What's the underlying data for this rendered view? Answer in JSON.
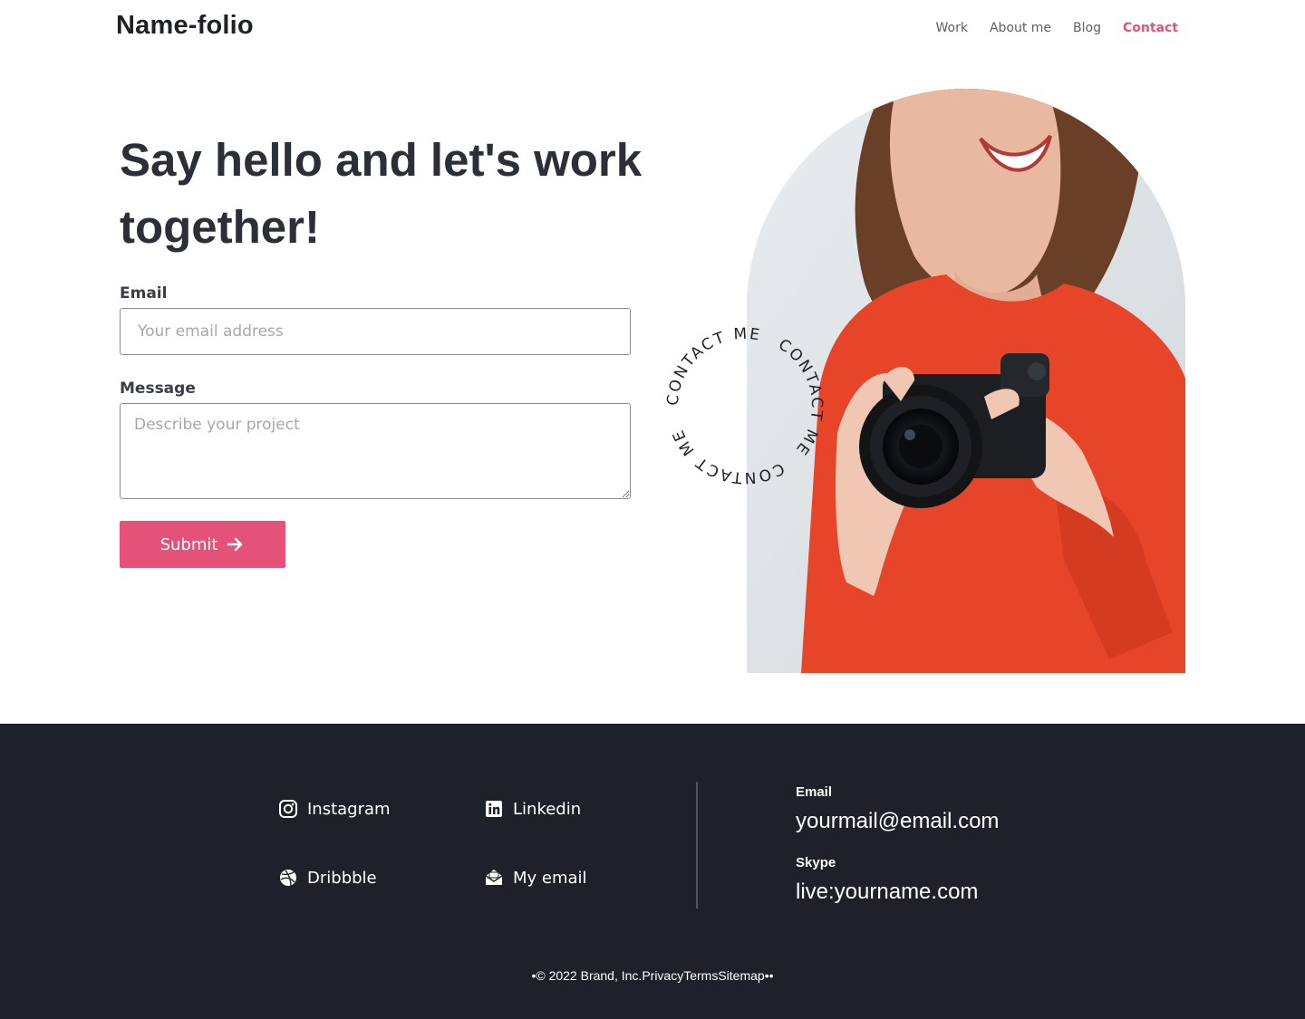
{
  "header": {
    "logo": "Name-folio",
    "nav": [
      {
        "label": "Work"
      },
      {
        "label": "About me"
      },
      {
        "label": "Blog"
      },
      {
        "label": "Contact",
        "active": true
      }
    ]
  },
  "hero": {
    "title": "Say hello and let's work together!",
    "email_label": "Email",
    "email_placeholder": "Your email address",
    "message_label": "Message",
    "message_placeholder": "Describe your project",
    "submit_label": "Submit",
    "badge_text": "CONTACT ME"
  },
  "footer": {
    "links": {
      "instagram": "Instagram",
      "linkedin": "Linkedin",
      "dribbble": "Dribbble",
      "email": "My email"
    },
    "email_label": "Email",
    "email_value": "yourmail@email.com",
    "skype_label": "Skype",
    "skype_value": "live:yourname.com",
    "copyright_prefix": "•© 2022 Brand, Inc.",
    "privacy": "Privacy",
    "terms": "Terms",
    "sitemap": "Sitemap",
    "copyright_suffix": "••"
  },
  "colors": {
    "accent": "#e4527a",
    "footer_bg": "#1e2129",
    "sweater": "#e6452a"
  }
}
